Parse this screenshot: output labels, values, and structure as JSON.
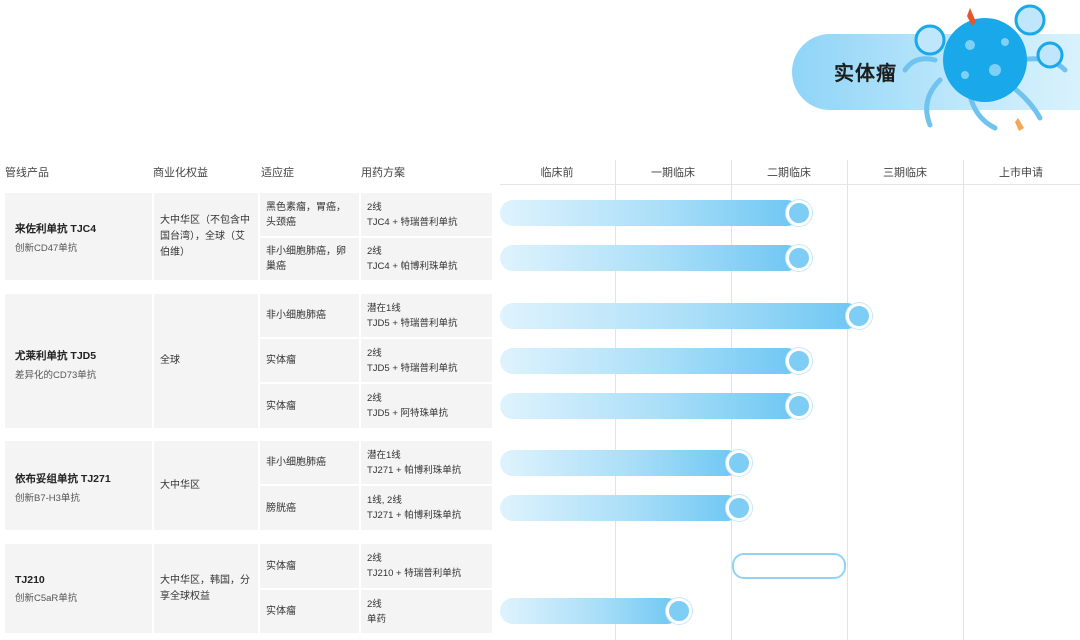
{
  "title": "实体瘤",
  "headers": {
    "product": "管线产品",
    "rights": "商业化权益",
    "indication": "适应症",
    "regimen": "用药方案"
  },
  "stages": [
    "临床前",
    "一期临床",
    "二期临床",
    "三期临床",
    "上市申请"
  ],
  "products": [
    {
      "name": "来佐利单抗 TJC4",
      "desc": "创新CD47单抗",
      "rights": "大中华区（不包含中国台湾），全球（艾伯维）",
      "rows": [
        {
          "indication": "黑色素瘤，胃癌，头颈癌",
          "line": "2线",
          "regimen": "TJC4 + 特瑞普利单抗",
          "progress": 0.25
        },
        {
          "indication": "非小细胞肺癌，卵巢癌",
          "line": "2线",
          "regimen": "TJC4 + 帕博利珠单抗",
          "progress": 0.25
        }
      ]
    },
    {
      "name": "尤莱利单抗 TJD5",
      "desc": "差异化的CD73单抗",
      "rights": "全球",
      "rows": [
        {
          "indication": "非小细胞肺癌",
          "line": "潜在1线",
          "regimen": "TJD5 + 特瑞普利单抗",
          "progress": 0.3
        },
        {
          "indication": "实体瘤",
          "line": "2线",
          "regimen": "TJD5 + 特瑞普利单抗",
          "progress": 0.25
        },
        {
          "indication": "实体瘤",
          "line": "2线",
          "regimen": "TJD5 + 阿特珠单抗",
          "progress": 0.25
        }
      ]
    },
    {
      "name": "依布妥组单抗 TJ271",
      "desc": "创新B7-H3单抗",
      "rights": "大中华区",
      "rows": [
        {
          "indication": "非小细胞肺癌",
          "line": "潜在1线",
          "regimen": "TJ271 + 帕博利珠单抗",
          "progress": 0.2
        },
        {
          "indication": "膀胱癌",
          "line": "1线, 2线",
          "regimen": "TJ271 + 帕博利珠单抗",
          "progress": 0.2
        }
      ]
    },
    {
      "name": "TJ210",
      "desc": "创新C5aR单抗",
      "rights": "大中华区，韩国，分享全球权益",
      "rows": [
        {
          "indication": "实体瘤",
          "line": "2线",
          "regimen": "TJ210 + 特瑞普利单抗",
          "progress": 0.2,
          "outline": true
        },
        {
          "indication": "实体瘤",
          "line": "2线",
          "regimen": "单药",
          "progress": 0.15
        }
      ]
    }
  ]
}
